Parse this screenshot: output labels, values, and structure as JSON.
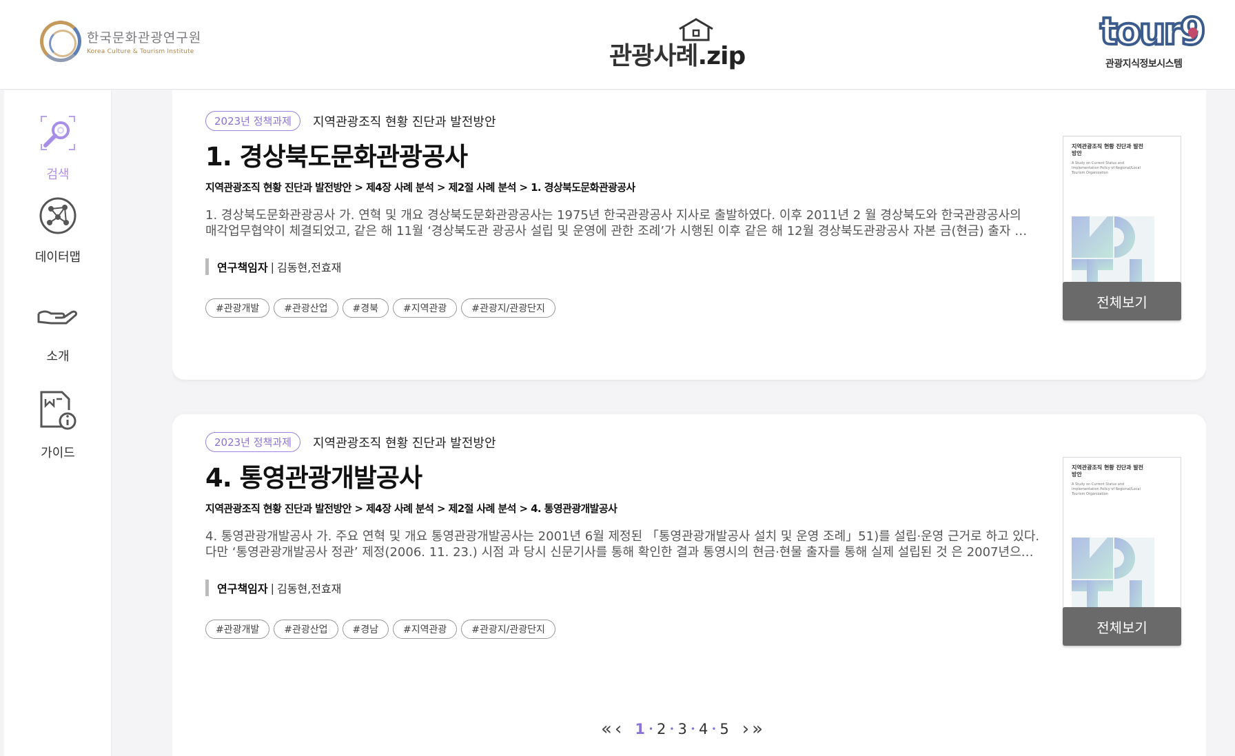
{
  "header": {
    "org_name_ko": "한국문화관광연구원",
    "org_name_en": "Korea Culture & Tourism Institute",
    "site_title": "관광사례",
    "site_title_suffix": ".zip",
    "partner_logo": "tour9",
    "partner_subtitle": "관광지식정보시스템"
  },
  "sidebar": {
    "items": [
      {
        "label": "검색",
        "icon": "search-icon",
        "active": true
      },
      {
        "label": "데이터맵",
        "icon": "network-icon",
        "active": false
      },
      {
        "label": "소개",
        "icon": "hand-icon",
        "active": false
      },
      {
        "label": "가이드",
        "icon": "guide-icon",
        "active": false
      }
    ]
  },
  "results": [
    {
      "badge": "2023년 정책과제",
      "project": "지역관광조직 현황 진단과 발전방안",
      "title": "1. 경상북도문화관광공사",
      "breadcrumb": "지역관광조직 현황 진단과 발전방안 > 제4장 사례 분석 > 제2절 사례 분석 > 1. 경상북도문화관광공사",
      "snippet_line1": "1. 경상북도문화관광공사 가. 연혁 및 개요 경상북도문화관광공사는 1975년 한국관광공사 지사로 출발하였다. 이후 2011년 2 월 경상북도와 한국관광공사의",
      "snippet_line2": "매각업무협약이 체결되었고, 같은 해 11월 ‘경상북도관 광공사 설립 및 운영에 관한 조례’가 시행된 이후 같은 해 12월 경상북도관광공사 자본 금(현금) 출자 …",
      "author_key": "연구책임자",
      "author_sep": "|",
      "author_val": "김동현,전효재",
      "tags": [
        "#관광개발",
        "#관광산업",
        "#경북",
        "#지역관광",
        "#관광지/관광단지"
      ],
      "cover_title": "지역관광조직 현황 진단과 발전방안",
      "cover_subtitle": "A Study on Current Status and Implementation Policy of Regional/Local Tourism Organization",
      "button": "전체보기"
    },
    {
      "badge": "2023년 정책과제",
      "project": "지역관광조직 현황 진단과 발전방안",
      "title": "4. 통영관광개발공사",
      "breadcrumb": "지역관광조직 현황 진단과 발전방안 > 제4장 사례 분석 > 제2절 사례 분석 > 4. 통영관광개발공사",
      "snippet_line1": "4. 통영관광개발공사 가. 주요 연혁 및 개요 통영관광개발공사는 2001년 6월 제정된 「통영관광개발공사 설치 및 운영 조례」51)를 설립·운영 근거로 하고 있다.",
      "snippet_line2": "다만 ‘통영관광개발공사 정관’ 제정(2006. 11. 23.) 시점 과 당시 신문기사를 통해 확인한 결과 통영시의 현금·현물 출자를 통해 실제 설립된 것 은 2007년으…",
      "author_key": "연구책임자",
      "author_sep": "|",
      "author_val": "김동현,전효재",
      "tags": [
        "#관광개발",
        "#관광산업",
        "#경남",
        "#지역관광",
        "#관광지/관광단지"
      ],
      "cover_title": "지역관광조직 현황 진단과 발전방안",
      "cover_subtitle": "A Study on Current Status and Implementation Policy of Regional/Local Tourism Organization",
      "button": "전체보기"
    }
  ],
  "pagination": {
    "first": "«",
    "prev": "‹",
    "pages": [
      "1",
      "2",
      "3",
      "4",
      "5"
    ],
    "current": "1",
    "next": "›",
    "last": "»"
  },
  "colors": {
    "accent": "#8a72d6",
    "active_nav": "#b390e8",
    "button_bg": "#6a6a6a"
  }
}
